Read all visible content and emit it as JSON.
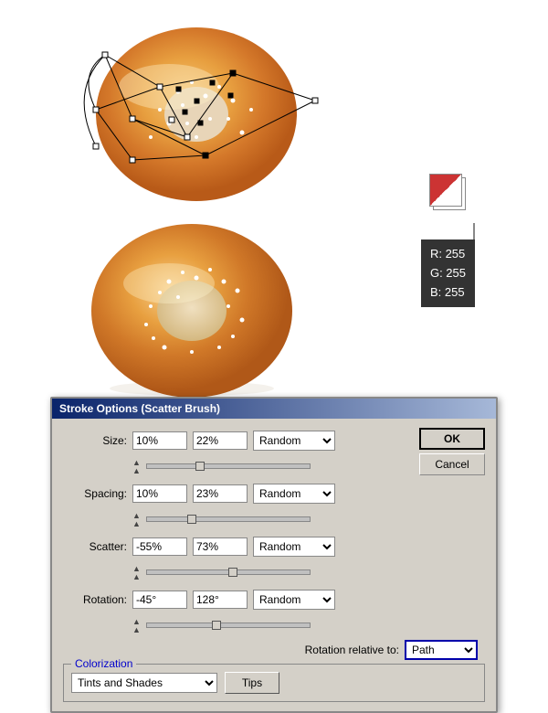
{
  "canvas": {
    "background": "#ffffff"
  },
  "color_info": {
    "r": "R: 255",
    "g": "G: 255",
    "b": "B: 255"
  },
  "dialog": {
    "title": "Stroke Options (Scatter Brush)",
    "rows": [
      {
        "label": "Size:",
        "val1": "10%",
        "val2": "22%",
        "dropdown": "Random"
      },
      {
        "label": "Spacing:",
        "val1": "10%",
        "val2": "23%",
        "dropdown": "Random"
      },
      {
        "label": "Scatter:",
        "val1": "-55%",
        "val2": "73%",
        "dropdown": "Random"
      },
      {
        "label": "Rotation:",
        "val1": "-45°",
        "val2": "128°",
        "dropdown": "Random"
      }
    ],
    "rotation_relative_label": "Rotation relative to:",
    "rotation_relative_value": "Path",
    "colorization_label": "Colorization",
    "colorization_method": "Tints and Shades",
    "tips_label": "Tips",
    "ok_label": "OK",
    "cancel_label": "Cancel"
  }
}
